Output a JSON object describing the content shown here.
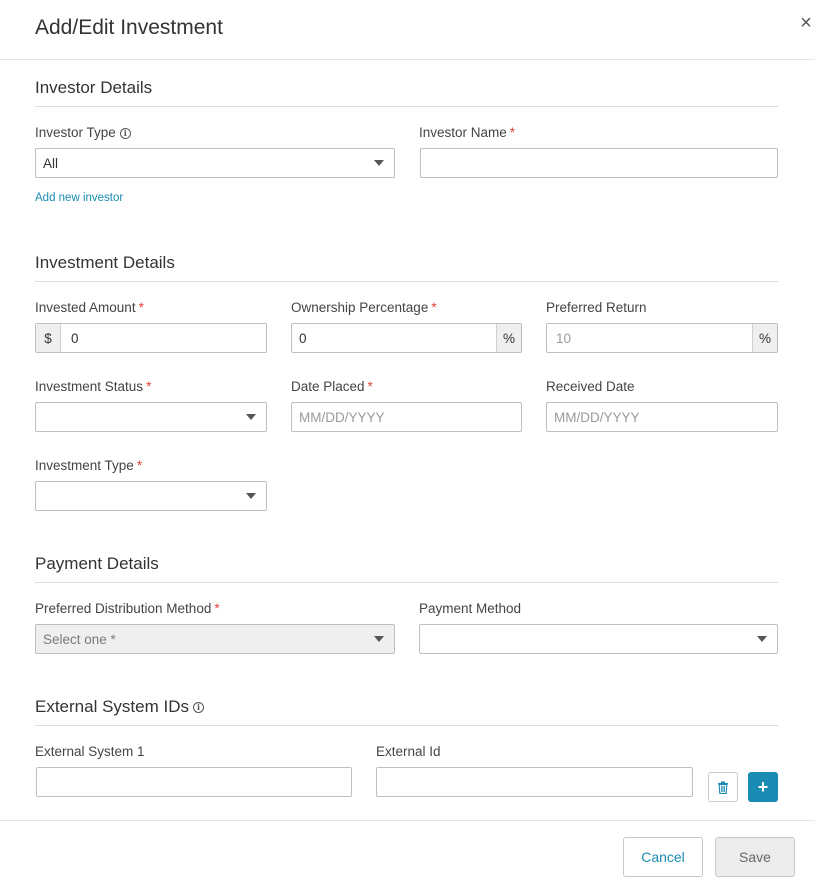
{
  "modal": {
    "title": "Add/Edit Investment",
    "close_glyph": "×"
  },
  "investor_details": {
    "title": "Investor Details",
    "investor_type": {
      "label": "Investor Type",
      "value": "All"
    },
    "investor_name": {
      "label": "Investor Name",
      "required": "*",
      "value": ""
    },
    "add_new_investor": "Add new investor"
  },
  "investment_details": {
    "title": "Investment Details",
    "invested_amount": {
      "label": "Invested Amount",
      "required": "*",
      "prefix": "$",
      "value": "0"
    },
    "ownership_percentage": {
      "label": "Ownership Percentage",
      "required": "*",
      "suffix": "%",
      "value": "0"
    },
    "preferred_return": {
      "label": "Preferred Return",
      "suffix": "%",
      "placeholder": "10"
    },
    "investment_status": {
      "label": "Investment Status",
      "required": "*",
      "value": ""
    },
    "date_placed": {
      "label": "Date Placed",
      "required": "*",
      "placeholder": "MM/DD/YYYY"
    },
    "received_date": {
      "label": "Received Date",
      "placeholder": "MM/DD/YYYY"
    },
    "investment_type": {
      "label": "Investment Type",
      "required": "*",
      "value": ""
    }
  },
  "payment_details": {
    "title": "Payment Details",
    "preferred_distribution_method": {
      "label": "Preferred Distribution Method",
      "required": "*",
      "placeholder": "Select one *"
    },
    "payment_method": {
      "label": "Payment Method",
      "value": ""
    }
  },
  "external_system_ids": {
    "title": "External System IDs",
    "external_system_label": "External System 1",
    "external_id_label": "External Id",
    "add_glyph": "+"
  },
  "footer": {
    "cancel_label": "Cancel",
    "save_label": "Save"
  },
  "icons": {
    "info": "info-icon",
    "caret": "chevron-down-icon",
    "trash": "trash-icon",
    "plus": "plus-icon",
    "close": "close-icon"
  },
  "colors": {
    "accent": "#1a8bb3",
    "required": "#e0443c",
    "disabled_bg": "#efefef"
  }
}
